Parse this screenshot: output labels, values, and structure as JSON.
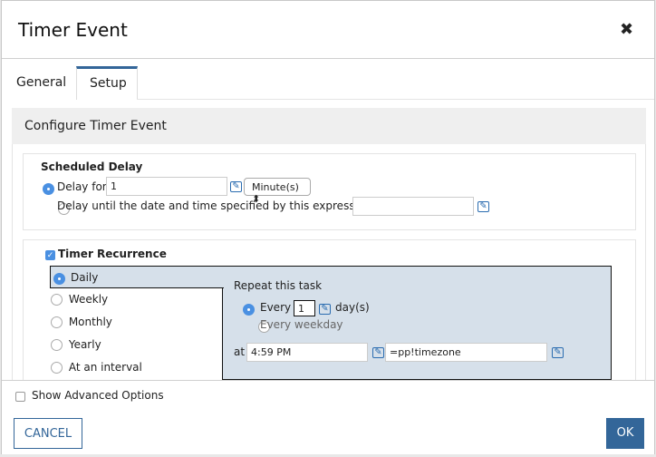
{
  "dialog": {
    "title": "Timer Event",
    "close_icon": "close-icon"
  },
  "tabs": [
    {
      "label": "General",
      "active": false
    },
    {
      "label": "Setup",
      "active": true
    }
  ],
  "section_title": "Configure Timer Event",
  "scheduled_delay": {
    "heading": "Scheduled Delay",
    "delay_for_label": "Delay for",
    "delay_for_value": "1",
    "unit": "Minute(s)",
    "delay_until_label": "Delay until the date and time specified by this expression:",
    "delay_until_value": "",
    "selected": "delay_for"
  },
  "recurrence": {
    "heading": "Timer Recurrence",
    "checked": true,
    "options": [
      "Daily",
      "Weekly",
      "Monthly",
      "Yearly",
      "At an interval"
    ],
    "selected": "Daily",
    "daily": {
      "repeat_label": "Repeat this task",
      "every_label": "Every",
      "every_value": "1",
      "days_label": "day(s)",
      "weekday_label": "Every weekday",
      "at_label": "at",
      "time_value": "4:59 PM",
      "timezone_value": "=pp!timezone"
    }
  },
  "advanced": {
    "label": "Show Advanced Options",
    "checked": false
  },
  "buttons": {
    "cancel": "CANCEL",
    "ok": "OK"
  },
  "colors": {
    "accent": "#336699",
    "selected_bg": "#d6e0ea",
    "radio": "#4a90e2"
  }
}
